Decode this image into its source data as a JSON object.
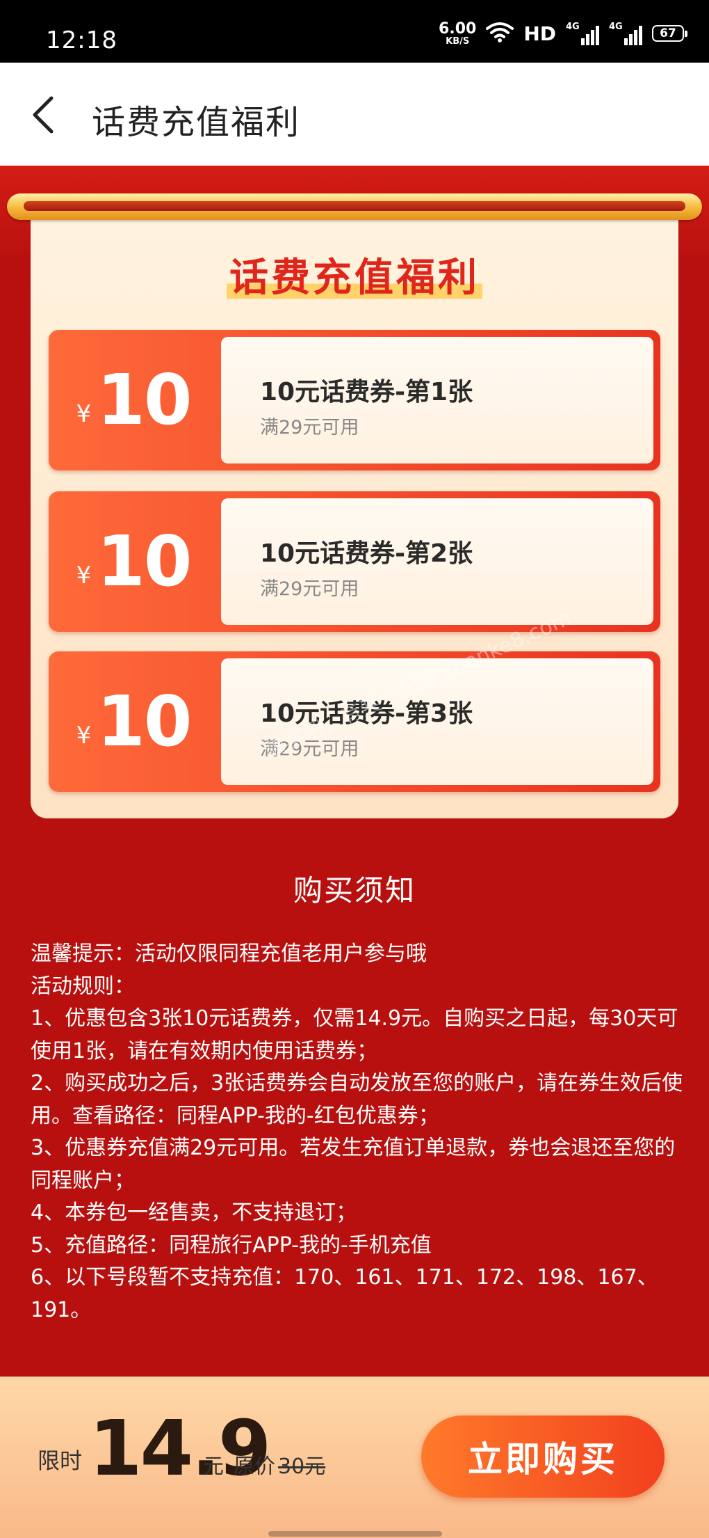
{
  "status_bar": {
    "time": "12:18",
    "net_speed_value": "6.00",
    "net_speed_unit": "KB/S",
    "hd": "HD",
    "signal1_label": "4G",
    "signal2_label": "4G",
    "battery": "67"
  },
  "header": {
    "title": "话费充值福利"
  },
  "panel": {
    "title": "话费充值福利",
    "coupons": [
      {
        "currency": "¥",
        "amount": "10",
        "name": "10元话费券-第1张",
        "condition": "满29元可用"
      },
      {
        "currency": "¥",
        "amount": "10",
        "name": "10元话费券-第2张",
        "condition": "满29元可用"
      },
      {
        "currency": "¥",
        "amount": "10",
        "name": "10元话费券-第3张",
        "condition": "满29元可用"
      }
    ]
  },
  "watermark": "赚客吧，有奖一起赚 zuanke8.com",
  "notice": {
    "title": "购买须知",
    "lines": [
      "温馨提示：活动仅限同程充值老用户参与哦",
      "活动规则：",
      "1、优惠包含3张10元话费券，仅需14.9元。自购买之日起，每30天可使用1张，请在有效期内使用话费券；",
      "2、购买成功之后，3张话费券会自动发放至您的账户，请在券生效后使用。查看路径：同程APP-我的-红包优惠券；",
      "3、优惠券充值满29元可用。若发生充值订单退款，券也会退还至您的同程账户；",
      "4、本券包一经售卖，不支持退订；",
      "5、充值路径：同程旅行APP-我的-手机充值",
      "6、以下号段暂不支持充值：170、161、171、172、198、167、191。"
    ]
  },
  "bottom_bar": {
    "limit_label": "限时",
    "price": "14.9",
    "unit": "元",
    "original_label": "原价",
    "original_price": "30元",
    "buy_label": "立即购买"
  }
}
